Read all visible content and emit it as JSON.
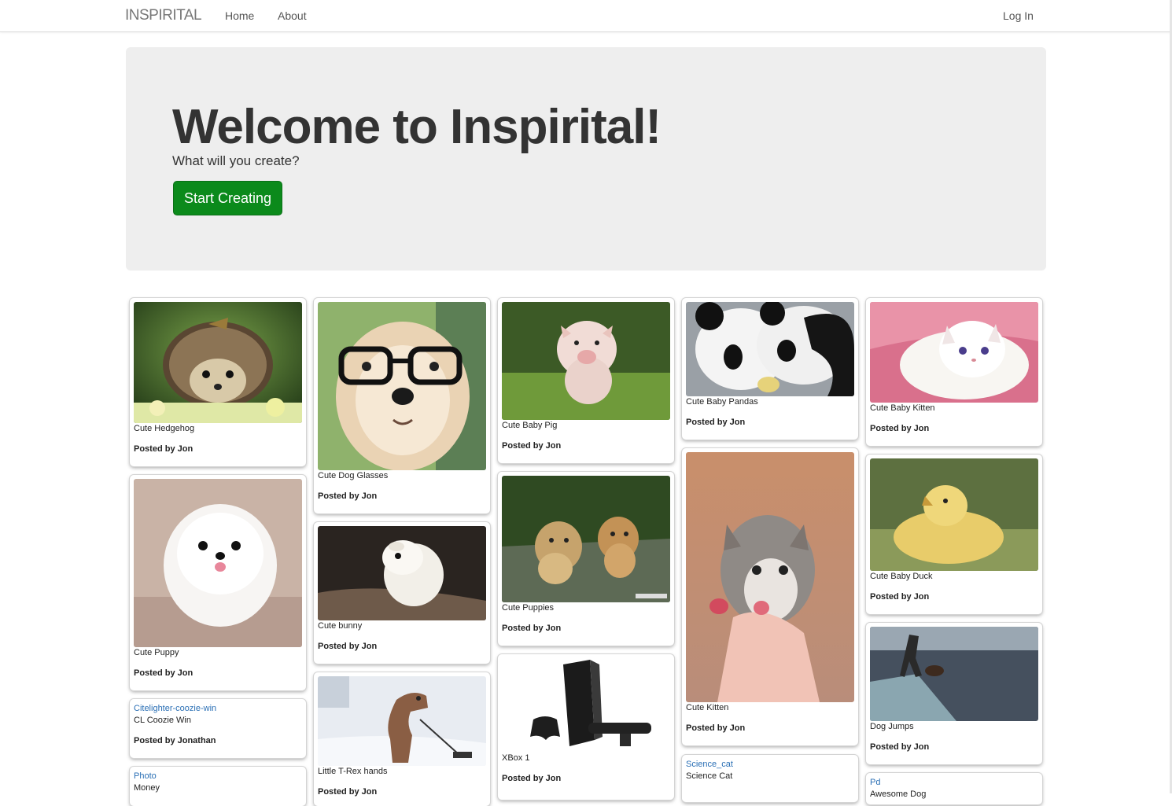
{
  "navbar": {
    "brand": "INSPIRITAL",
    "home": "Home",
    "about": "About",
    "login": "Log In"
  },
  "jumbotron": {
    "title": "Welcome to Inspirital!",
    "lead": "What will you create?",
    "button": "Start Creating"
  },
  "pins": [
    {
      "caption": "Cute Hedgehog",
      "posted_by": "Posted by Jon",
      "image": "hedgehog-photo"
    },
    {
      "caption": "Cute Puppy",
      "posted_by": "Posted by Jon",
      "image": "white-puppy-photo"
    },
    {
      "link": "Citelighter-coozie-win",
      "caption": "CL Coozie Win",
      "posted_by": "Posted by Jonathan"
    },
    {
      "link": "Photo",
      "caption": "Money"
    },
    {
      "caption": "Cute Dog Glasses",
      "posted_by": "Posted by Jon",
      "image": "dog-glasses-photo"
    },
    {
      "caption": "Cute bunny",
      "posted_by": "Posted by Jon",
      "image": "bunny-photo"
    },
    {
      "caption": "Little T-Rex hands",
      "posted_by": "Posted by Jon",
      "image": "trex-photo"
    },
    {
      "caption": "Cute Baby Pig",
      "posted_by": "Posted by Jon",
      "image": "piglet-photo"
    },
    {
      "caption": "Cute Puppies",
      "posted_by": "Posted by Jon",
      "image": "puppies-photo"
    },
    {
      "caption": "XBox 1",
      "posted_by": "Posted by Jon",
      "image": "xbox-photo"
    },
    {
      "caption": "Cute Baby Pandas",
      "posted_by": "Posted by Jon",
      "image": "pandas-photo"
    },
    {
      "caption": "Cute Kitten",
      "posted_by": "Posted by Jon",
      "image": "kitten-photo"
    },
    {
      "link": "Science_cat",
      "caption": "Science Cat"
    },
    {
      "caption": "Cute Baby Kitten",
      "posted_by": "Posted by Jon",
      "image": "white-kitten-photo"
    },
    {
      "caption": "Cute Baby Duck",
      "posted_by": "Posted by Jon",
      "image": "duckling-photo"
    },
    {
      "caption": "Dog Jumps",
      "posted_by": "Posted by Jon",
      "image": "dog-jump-photo"
    },
    {
      "link": "Pd",
      "caption": "Awesome Dog"
    }
  ]
}
